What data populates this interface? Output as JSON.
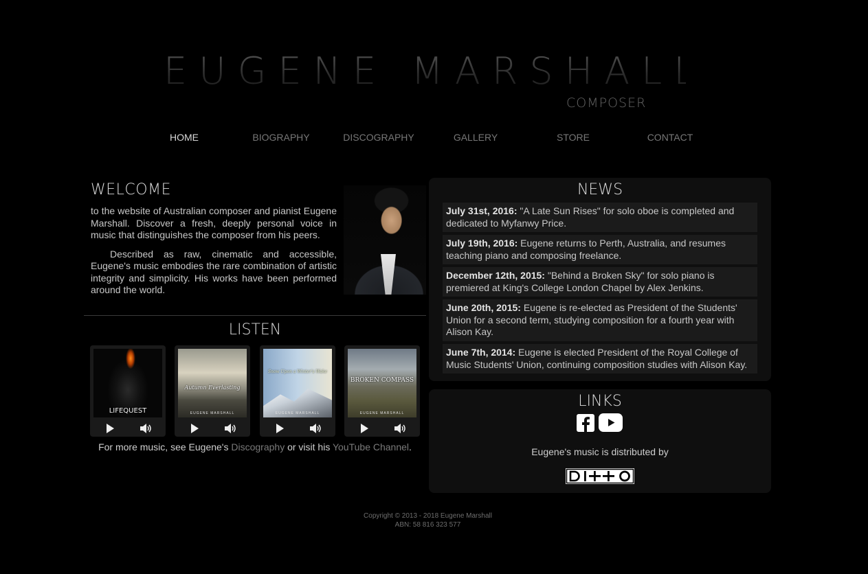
{
  "header": {
    "name": "EUGENE MARSHALL",
    "subtitle": "COMPOSER"
  },
  "nav": {
    "items": [
      {
        "label": "HOME",
        "active": true
      },
      {
        "label": "BIOGRAPHY",
        "active": false
      },
      {
        "label": "DISCOGRAPHY",
        "active": false
      },
      {
        "label": "GALLERY",
        "active": false
      },
      {
        "label": "STORE",
        "active": false
      },
      {
        "label": "CONTACT",
        "active": false
      }
    ]
  },
  "welcome": {
    "title": "WELCOME",
    "paragraphs": [
      "to the website of Australian composer and pianist Eugene Marshall. Discover a fresh, deeply personal voice in music that distinguishes the composer from his peers.",
      "Described as raw, cinematic and accessible, Eugene's music embodies the rare combination of artistic integrity and simplicity. His works have been performed around the world."
    ]
  },
  "listen": {
    "title": "LISTEN",
    "albums": [
      {
        "title": "LIFEQUEST",
        "artist": ""
      },
      {
        "title": "Autumn Everlasting",
        "artist": "EUGENE MARSHALL"
      },
      {
        "title": "Snow Upon a Winter's Wake",
        "artist": "EUGENE MARSHALL"
      },
      {
        "title": "BROKEN COMPASS",
        "artist": "EUGENE MARSHALL"
      }
    ],
    "more_prefix": "For more music, see Eugene's ",
    "discography_link": "Discography",
    "more_middle": " or visit his ",
    "youtube_link": "YouTube Channel",
    "more_suffix": "."
  },
  "news": {
    "title": "NEWS",
    "items": [
      {
        "date": "July 31st, 2016:",
        "text": " \"A Late Sun Rises\" for solo oboe is completed and dedicated to Myfanwy Price."
      },
      {
        "date": "July 19th, 2016:",
        "text": " Eugene returns to Perth, Australia, and resumes teaching piano and composing freelance."
      },
      {
        "date": "December 12th, 2015:",
        "text": " \"Behind a Broken Sky\" for solo piano is premiered at King's College London Chapel by Alex Jenkins."
      },
      {
        "date": "June 20th, 2015:",
        "text": " Eugene is re-elected as President of the Students' Union for a second term, studying composition for a fourth year with Alison Kay."
      },
      {
        "date": "June 7th, 2014:",
        "text": " Eugene is elected President of the Royal College of Music Students' Union, continuing composition studies with Alison Kay."
      }
    ]
  },
  "links": {
    "title": "LINKS",
    "distributed_by": "Eugene's music is distributed by",
    "distributor_logo": "DITTO"
  },
  "footer": {
    "copyright": "Copyright © 2013 - 2018 Eugene Marshall",
    "abn": "ABN: 58 816 323 577"
  },
  "icons": [
    "play-icon",
    "volume-icon",
    "facebook-icon",
    "youtube-icon"
  ],
  "colors": {
    "background": "#000000",
    "panel": "#0f0f0f",
    "news_item": "#1b1b1b",
    "link": "#7a7a7a"
  }
}
